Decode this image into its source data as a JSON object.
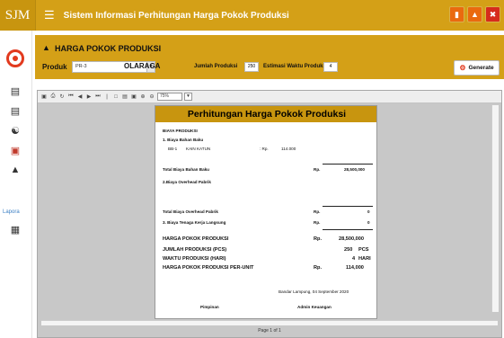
{
  "titlebar": {
    "logo": "SJM",
    "app_title": "Sistem Informasi Perhitungan Harga Pokok Produksi"
  },
  "sidebar": {
    "laporan_label": "Lapora"
  },
  "header": {
    "page_title": "HARGA POKOK PRODUKSI",
    "produk_label": "Produk",
    "produk_value": "PR-3",
    "produk_name": "OLARAGA",
    "jumlah_label": "Jumlah Produksi",
    "jumlah_value": "250",
    "estimasi_label": "Estimasi Waktu Produksi",
    "estimasi_value": "4",
    "generate_label": "Generate"
  },
  "viewer": {
    "zoom": "75%",
    "page_indicator": "Page 1 of 1"
  },
  "report": {
    "title": "Perhitungan Harga Pokok Produksi",
    "biaya_produksi": "BIAYA PRODUKSI",
    "biaya_bahan_baku": "1. Biaya Bahan Baku",
    "bb_code": "BB-1",
    "bb_name": "KAIN KATUN",
    "bb_rp": ": Rp.",
    "bb_value": "114.000",
    "total_bb_label": "Total Biaya Bahan Baku",
    "total_bb_rp": "Rp.",
    "total_bb_value": "28,500,000",
    "overhead_label": "2.Biaya Overhead Pabrik",
    "total_overhead_label": "Total Biaya Overhead Pabrik",
    "total_overhead_rp": "Rp.",
    "total_overhead_value": "0",
    "tenaga_label": "3. Biaya Tenaga Kerja Langsung",
    "tenaga_rp": "Rp.",
    "tenaga_value": "0",
    "hpp_label": "HARGA POKOK PRODUKSI",
    "hpp_rp": "Rp.",
    "hpp_value": "28,500,000",
    "jumlah_label": "JUMLAH PRODUKSI (PCS)",
    "jumlah_value": "250",
    "jumlah_unit": "PCS",
    "waktu_label": "WAKTU PRODUKSI (HARI)",
    "waktu_value": "4",
    "waktu_unit": "HARI",
    "per_unit_label": "HARGA POKOK PRODUKSI PER-UNIT",
    "per_unit_rp": "Rp.",
    "per_unit_value": "114,000",
    "date_line": "Bandar Lampung, 04 September 2020",
    "pimpinan": "Pimpinan",
    "admin": "Admin Keuangan"
  },
  "colors": {
    "accent": "#d4a017",
    "report_header": "#c8950f",
    "close_red": "#d62b1c",
    "orange": "#ea6a0f"
  }
}
